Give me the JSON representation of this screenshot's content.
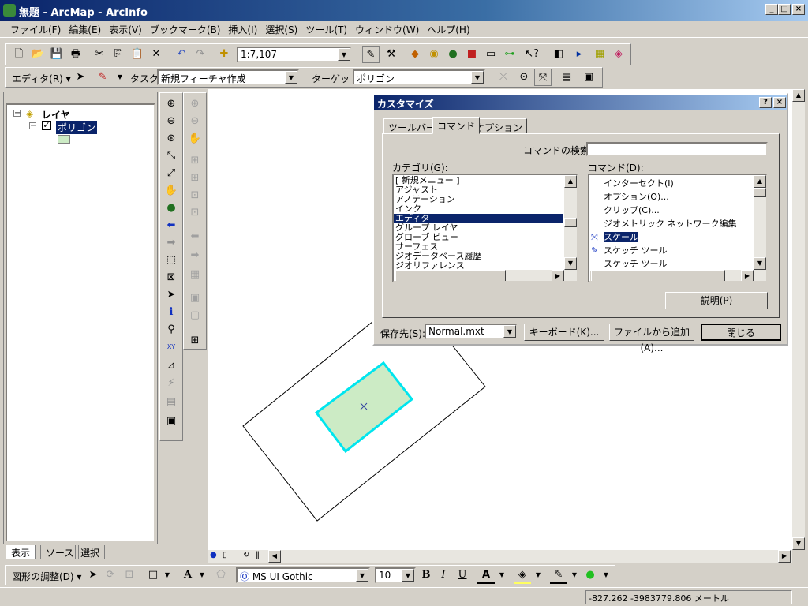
{
  "window": {
    "title": "無題 - ArcMap - ArcInfo",
    "controls": [
      "_",
      "□",
      "×"
    ]
  },
  "menu": [
    "ファイル(F)",
    "編集(E)",
    "表示(V)",
    "ブックマーク(B)",
    "挿入(I)",
    "選択(S)",
    "ツール(T)",
    "ウィンドウ(W)",
    "ヘルプ(H)"
  ],
  "standard_toolbar": {
    "scale": "1:7,107"
  },
  "editor_toolbar": {
    "editor_label": "エディタ(R) ▾",
    "task_label": "タスク:",
    "task_value": "新規フィーチャ作成",
    "target_label": "ターゲット:",
    "target_value": "ポリゴン"
  },
  "toc": {
    "root": "レイヤ",
    "layer": "ポリゴン",
    "tabs": [
      "表示",
      "ソース",
      "選択"
    ]
  },
  "dialog": {
    "title": "カスタマイズ",
    "tabs": [
      "ツールバー",
      "コマンド",
      "オプション"
    ],
    "search_label": "コマンドの検索:",
    "search_value": "",
    "category_label": "カテゴリ(G):",
    "categories": [
      "[ 新規メニュー ]",
      "アジャスト",
      "アノテーション",
      "インク",
      "エディタ",
      "グループ レイヤ",
      "グローブ ビュー",
      "サーフェス",
      "ジオデータベース履歴",
      "ジオリファレンス"
    ],
    "category_selected": 4,
    "commands_label": "コマンド(D):",
    "commands": [
      "インターセクト(I)",
      "オプション(O)...",
      "クリップ(C)...",
      "ジオメトリック ネットワーク編集",
      "スケール",
      "スケッチ ツール",
      "スケッチ ツール"
    ],
    "command_selected": 4,
    "describe_button": "説明(P)",
    "save_label": "保存先(S):",
    "save_value": "Normal.mxt",
    "keyboard_button": "キーボード(K)...",
    "add_from_file_button": "ファイルから追加(A)...",
    "close_button": "閉じる",
    "help_button": "?",
    "x_button": "×"
  },
  "drawing_toolbar": {
    "label": "図形の調整(D) ▾",
    "font": "MS UI Gothic",
    "size": "10",
    "bold": "B",
    "italic": "I",
    "underline": "U"
  },
  "status": {
    "coords": "-827.262  -3983779.806 メートル"
  },
  "colors": {
    "polygon_fill": "#ccebc5",
    "polygon_outline": "#00e5ee",
    "selection": "#0a246a"
  }
}
